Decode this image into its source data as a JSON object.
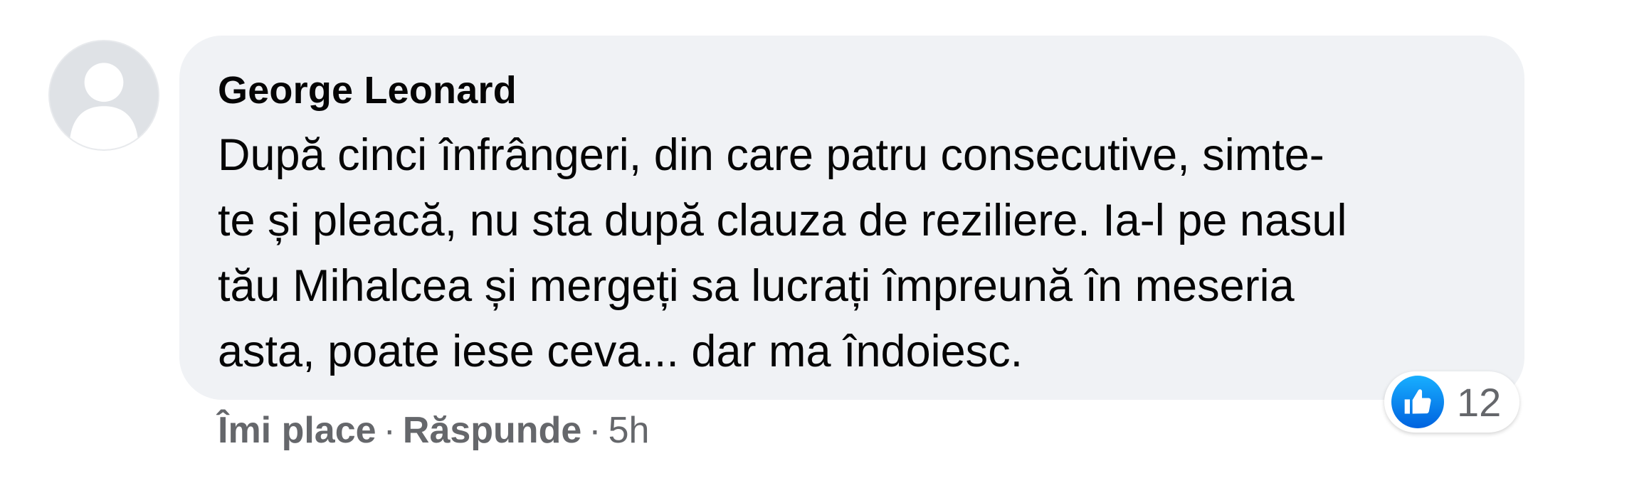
{
  "comment": {
    "author": "George Leonard",
    "text": "După cinci înfrângeri, din care patru consecutive, simte-\nte și pleacă, nu sta după clauza de reziliere. Ia-l pe nasul\ntău Mihalcea și mergeți sa lucrați împreună în meseria\nasta, poate iese ceva... dar ma îndoiesc.",
    "avatar_icon": "default-profile-silhouette"
  },
  "actions": {
    "like_label": "Îmi place",
    "reply_label": "Răspunde",
    "separator": "·",
    "timestamp": "5h"
  },
  "reactions": {
    "icon": "thumbs-up-icon",
    "count": "12",
    "color": "#1877f2"
  },
  "colors": {
    "bubble_bg": "#f0f2f5",
    "secondary_text": "#65676b",
    "primary_text": "#050505"
  }
}
